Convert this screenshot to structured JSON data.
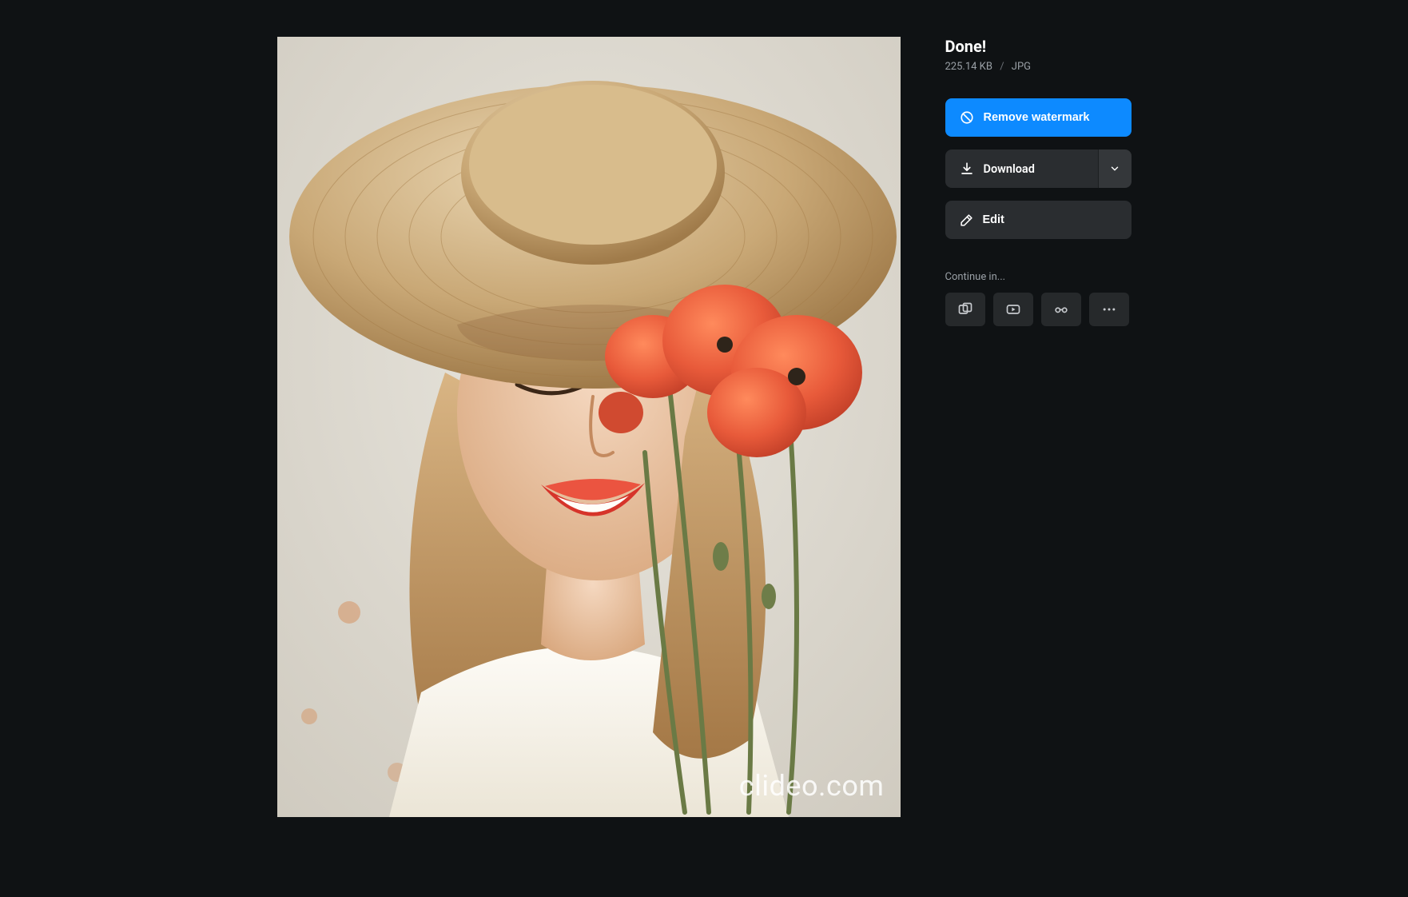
{
  "sidebar": {
    "title": "Done!",
    "file_size": "225.14 KB",
    "file_format": "JPG",
    "remove_watermark_label": "Remove watermark",
    "download_label": "Download",
    "edit_label": "Edit",
    "continue_label": "Continue in...",
    "continue_icons": [
      "layers-icon",
      "video-icon",
      "glasses-icon",
      "more-icon"
    ]
  },
  "preview": {
    "watermark": "clideo.com"
  }
}
